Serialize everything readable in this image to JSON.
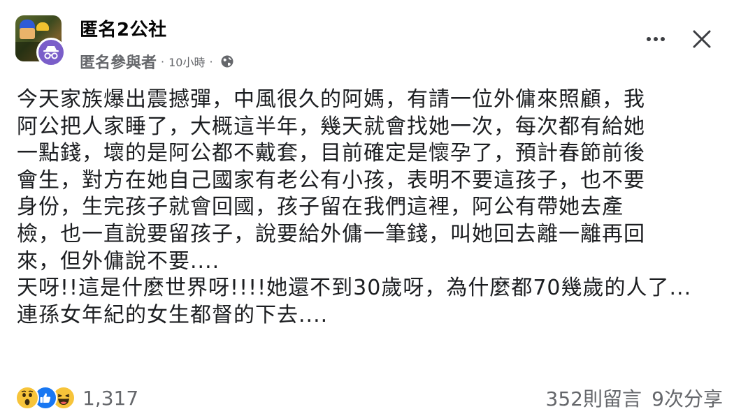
{
  "post": {
    "group_name": "匿名2公社",
    "author": "匿名參與者",
    "separator": "·",
    "time": "10小時",
    "privacy_icon": "globe-icon",
    "body_lines": [
      "今天家族爆出震撼彈，中風很久的阿媽，有請一位外傭來照顧，我",
      "阿公把人家睡了，大概這半年，幾天就會找她一次，每次都有給她",
      "一點錢，壞的是阿公都不戴套，目前確定是懷孕了，預計春節前後",
      "會生，對方在她自己國家有老公有小孩，表明不要這孩子，也不要",
      "身份，生完孩子就會回國，孩子留在我們這裡，阿公有帶她去產",
      "檢，也一直說要留孩子，說要給外傭一筆錢，叫她回去離一離再回",
      "來，但外傭說不要....",
      "天呀!!這是什麼世界呀!!!!她還不到30歲呀，為什麼都70幾歲的人了...",
      "連孫女年紀的女生都督的下去...."
    ]
  },
  "footer": {
    "reaction_icons": [
      "wow-icon",
      "like-icon",
      "haha-icon"
    ],
    "reaction_count": "1,317",
    "comments": "352則留言",
    "shares": "9次分享"
  },
  "colors": {
    "text_primary": "#050505",
    "text_secondary": "#65676b",
    "like_blue": "#1877f2",
    "emoji_yellow": "#f7c43a",
    "anon_purple": "#7a5ec9"
  }
}
